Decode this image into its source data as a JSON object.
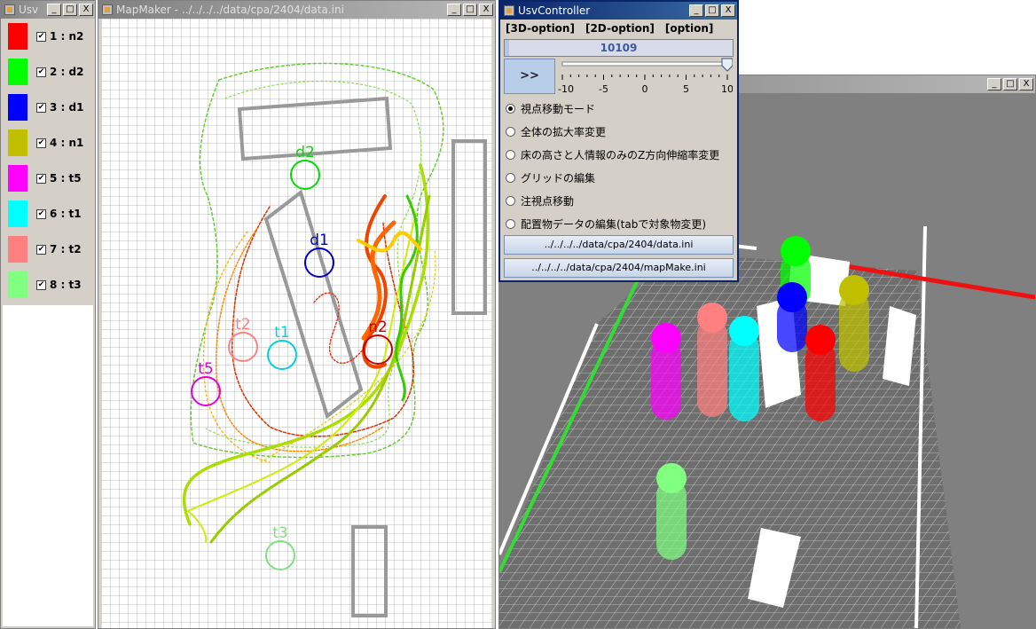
{
  "legend_window": {
    "title": "Usv",
    "items": [
      {
        "label": "1 : n2",
        "color": "#ff0000",
        "checked": true
      },
      {
        "label": "2 : d2",
        "color": "#00ff00",
        "checked": true
      },
      {
        "label": "3 : d1",
        "color": "#0000ff",
        "checked": true
      },
      {
        "label": "4 : n1",
        "color": "#c0c000",
        "checked": true
      },
      {
        "label": "5 : t5",
        "color": "#ff00ff",
        "checked": true
      },
      {
        "label": "6 : t1",
        "color": "#00ffff",
        "checked": true
      },
      {
        "label": "7 : t2",
        "color": "#ff8080",
        "checked": true
      },
      {
        "label": "8 : t3",
        "color": "#80ff80",
        "checked": true
      }
    ]
  },
  "map_window": {
    "title": "MapMaker - ../../../../data/cpa/2404/data.ini",
    "markers": [
      {
        "label": "d2",
        "color": "#00dd00"
      },
      {
        "label": "d1",
        "color": "#0000cc"
      },
      {
        "label": "n2",
        "color": "#cc0000"
      },
      {
        "label": "t1",
        "color": "#00d0e0"
      },
      {
        "label": "t2",
        "color": "#ff8080"
      },
      {
        "label": "t5",
        "color": "#e000e0"
      },
      {
        "label": "t3",
        "color": "#80e080"
      }
    ]
  },
  "controller_window": {
    "title": "UsvController",
    "menus": [
      "[3D-option]",
      "[2D-option]",
      "[option]"
    ],
    "frame_value": "10109",
    "frame_progress": 0.02,
    "play_label": ">>",
    "slider": {
      "min": -10,
      "max": 10,
      "value": 10,
      "ticks": [
        "-10",
        "-5",
        "0",
        "5",
        "10"
      ]
    },
    "modes": [
      {
        "label": "視点移動モード",
        "selected": true
      },
      {
        "label": "全体の拡大率変更",
        "selected": false
      },
      {
        "label": "床の高さと人情報のみのZ方向伸縮率変更",
        "selected": false
      },
      {
        "label": "グリッドの編集",
        "selected": false
      },
      {
        "label": "注視点移動",
        "selected": false
      },
      {
        "label": "配置物データの編集(tabで対象物変更)",
        "selected": false
      }
    ],
    "files": [
      "../../../../data/cpa/2404/data.ini",
      "../../../../data/cpa/2404/mapMake.ini"
    ]
  },
  "view3d_window": {
    "title": ""
  },
  "window_buttons": {
    "minimize": "_",
    "maximize": "□",
    "close": "X"
  }
}
